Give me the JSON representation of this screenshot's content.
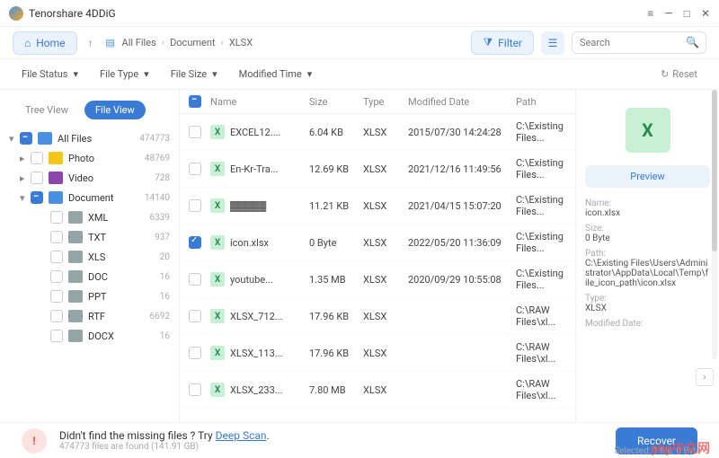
{
  "app": {
    "title": "Tenorshare 4DDiG"
  },
  "toolbar": {
    "home": "Home",
    "breadcrumb": [
      "All Files",
      "Document",
      "XLSX"
    ],
    "filter": "Filter",
    "search_placeholder": "Search"
  },
  "filters": {
    "file_status": "File Status",
    "file_type": "File Type",
    "file_size": "File Size",
    "modified_time": "Modified Time",
    "reset": "Reset"
  },
  "sidebar": {
    "tree_tab": "Tree View",
    "file_tab": "File View",
    "nodes": [
      {
        "label": "All Files",
        "count": "474773",
        "icon": "blue",
        "checked": true,
        "indent": 0,
        "chev": "▾"
      },
      {
        "label": "Photo",
        "count": "48769",
        "icon": "yellow",
        "checked": false,
        "indent": 1,
        "chev": "▸"
      },
      {
        "label": "Video",
        "count": "728",
        "icon": "purple",
        "checked": false,
        "indent": 1,
        "chev": "▸"
      },
      {
        "label": "Document",
        "count": "14140",
        "icon": "blue",
        "checked": true,
        "indent": 1,
        "chev": "▾"
      },
      {
        "label": "XML",
        "count": "6339",
        "icon": "grey",
        "checked": false,
        "indent": 2,
        "chev": ""
      },
      {
        "label": "TXT",
        "count": "937",
        "icon": "grey",
        "checked": false,
        "indent": 2,
        "chev": ""
      },
      {
        "label": "XLS",
        "count": "20",
        "icon": "grey",
        "checked": false,
        "indent": 2,
        "chev": ""
      },
      {
        "label": "DOC",
        "count": "16",
        "icon": "grey",
        "checked": false,
        "indent": 2,
        "chev": ""
      },
      {
        "label": "PPT",
        "count": "16",
        "icon": "grey",
        "checked": false,
        "indent": 2,
        "chev": ""
      },
      {
        "label": "RTF",
        "count": "6692",
        "icon": "grey",
        "checked": false,
        "indent": 2,
        "chev": ""
      },
      {
        "label": "DOCX",
        "count": "16",
        "icon": "grey",
        "checked": false,
        "indent": 2,
        "chev": ""
      }
    ]
  },
  "table": {
    "headers": {
      "name": "Name",
      "size": "Size",
      "type": "Type",
      "date": "Modified Date",
      "path": "Path"
    },
    "rows": [
      {
        "checked": false,
        "name": "EXCEL12....",
        "size": "6.04 KB",
        "type": "XLSX",
        "date": "2015/07/30 14:24:28",
        "path": "C:\\Existing Files..."
      },
      {
        "checked": false,
        "name": "En-Kr-Tra...",
        "size": "12.69 KB",
        "type": "XLSX",
        "date": "2021/12/16 11:49:56",
        "path": "C:\\Existing Files..."
      },
      {
        "checked": false,
        "name": "▓▓▓▓▓",
        "size": "11.21 KB",
        "type": "XLSX",
        "date": "2021/04/15 15:07:20",
        "path": "C:\\Existing Files..."
      },
      {
        "checked": true,
        "name": "icon.xlsx",
        "size": "0 Byte",
        "type": "XLSX",
        "date": "2022/05/20 11:36:09",
        "path": "C:\\Existing Files..."
      },
      {
        "checked": false,
        "name": "youtube...",
        "size": "1.35 MB",
        "type": "XLSX",
        "date": "2020/09/29 10:55:08",
        "path": "C:\\Existing Files..."
      },
      {
        "checked": false,
        "name": "XLSX_712...",
        "size": "17.96 KB",
        "type": "XLSX",
        "date": "",
        "path": "C:\\RAW Files\\xl..."
      },
      {
        "checked": false,
        "name": "XLSX_113...",
        "size": "17.96 KB",
        "type": "XLSX",
        "date": "",
        "path": "C:\\RAW Files\\xl..."
      },
      {
        "checked": false,
        "name": "XLSX_233...",
        "size": "7.80 MB",
        "type": "XLSX",
        "date": "",
        "path": "C:\\RAW Files\\xl..."
      }
    ]
  },
  "preview": {
    "button": "Preview",
    "fields": {
      "name_label": "Name:",
      "name": "icon.xlsx",
      "size_label": "Size:",
      "size": "0 Byte",
      "path_label": "Path:",
      "path": "C:\\Existing Files\\Users\\Administrator\\AppData\\Local\\Temp\\file_icon_path\\icon.xlsx",
      "type_label": "Type:",
      "type": "XLSX",
      "mod_label": "Modified Date:"
    }
  },
  "footer": {
    "msg_prefix": "Didn't find the missing files ? Try ",
    "deep_scan": "Deep Scan",
    "sub": "474773 files are found (141.91 GB)",
    "recover": "Recover",
    "selected": "Selected: 1 file, 0 Byte"
  },
  "watermark": "php中文网"
}
